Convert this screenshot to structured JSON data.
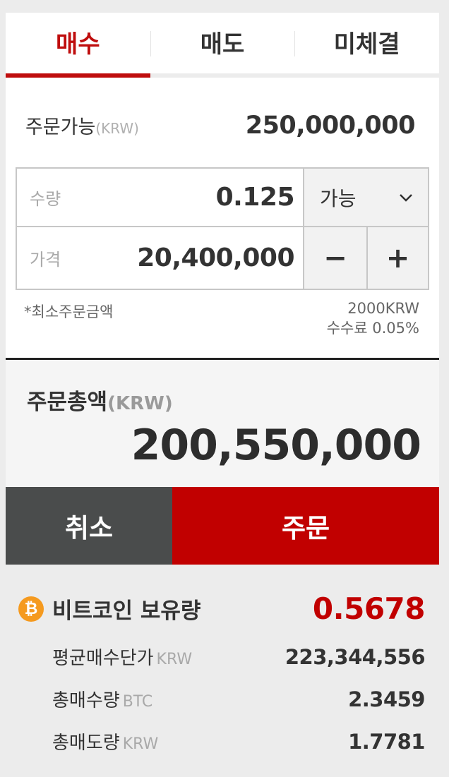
{
  "tabs": [
    {
      "label": "매수",
      "active": true
    },
    {
      "label": "매도",
      "active": false
    },
    {
      "label": "미체결",
      "active": false
    }
  ],
  "available": {
    "label": "주문가능",
    "unit": "(KRW)",
    "value": "250,000,000"
  },
  "quantity": {
    "label": "수량",
    "value": "0.125"
  },
  "price": {
    "label": "가격",
    "value": "20,400,000"
  },
  "dropdown": {
    "selected": "가능",
    "icon": "chevron-down-icon"
  },
  "stepper": {
    "minus": "−",
    "plus": "+"
  },
  "notes": {
    "min_order": "*최소주문금액",
    "min_order_amount": "2000KRW",
    "fee": "수수료 0.05%"
  },
  "total": {
    "label": "주문총액",
    "unit": "(KRW)",
    "value": "200,550,000"
  },
  "actions": {
    "cancel": "취소",
    "order": "주문"
  },
  "holdings": {
    "icon": "bitcoin-icon",
    "icon_glyph": "₿",
    "title": "비트코인 보유량",
    "value": "0.5678",
    "stats": [
      {
        "label": "평균매수단가",
        "unit": "KRW",
        "value": "223,344,556"
      },
      {
        "label": "총매수량",
        "unit": "BTC",
        "value": "2.3459"
      },
      {
        "label": "총매도량",
        "unit": "KRW",
        "value": "1.7781"
      }
    ]
  },
  "colors": {
    "accent": "#c10000",
    "cancel": "#4a4c4c",
    "coin": "#f59a1f"
  }
}
